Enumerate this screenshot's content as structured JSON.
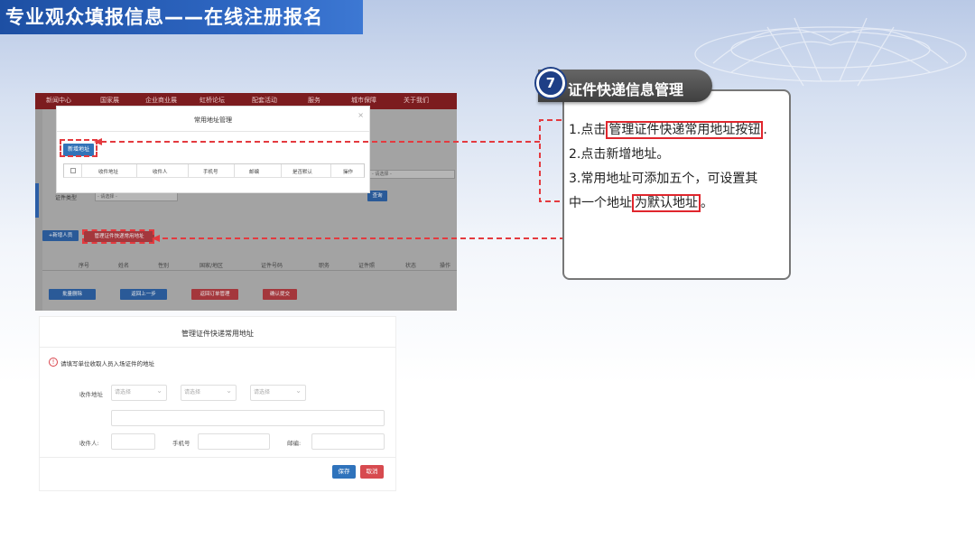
{
  "header": {
    "title": "专业观众填报信息——在线注册报名"
  },
  "step": {
    "number": "7",
    "title": "证件快递信息管理",
    "lines": [
      {
        "prefix": "1.点击",
        "highlight": "管理证件快递常用地址按钮",
        "suffix": "."
      },
      {
        "prefix": "2.点击新增地址。",
        "highlight": "",
        "suffix": ""
      },
      {
        "prefix": "3.常用地址可添加五个，可设置其",
        "highlight": "",
        "suffix": ""
      },
      {
        "prefix": "中一个地址",
        "highlight": "为默认地址",
        "suffix": "。"
      }
    ]
  },
  "registration": {
    "nav": [
      "新闻中心",
      "国家展",
      "企业商业展",
      "虹桥论坛",
      "配套活动",
      "服务",
      "城市保障",
      "关于我们"
    ],
    "select_placeholder": "- 请选择 -",
    "filter_label": "证件类型",
    "search_label": "查询",
    "new_person_button": "+新增人员",
    "manage_address_button": "管理证件快递常用地址",
    "table_headers": [
      "序号",
      "姓名",
      "性别",
      "国家/地区",
      "证件号码",
      "职务",
      "证件照",
      "状态",
      "操作"
    ],
    "footer_buttons": [
      "批量删除",
      "返回上一步",
      "返回订单管理",
      "确认提交"
    ]
  },
  "address_modal": {
    "title": "常用地址管理",
    "close": "×",
    "add_button": "新增地址",
    "columns": [
      "收件地址",
      "收件人",
      "手机号",
      "邮编",
      "是否默认",
      "操作"
    ]
  },
  "address_form": {
    "title": "管理证件快递常用地址",
    "warning": "请填写单位收取人员入场证件的地址",
    "address_label": "收件地址",
    "select_placeholder": "请选择",
    "recipient_label": "收件人:",
    "phone_label": "手机号",
    "zip_label": "邮编:",
    "save_button": "保存",
    "cancel_button": "取消"
  }
}
